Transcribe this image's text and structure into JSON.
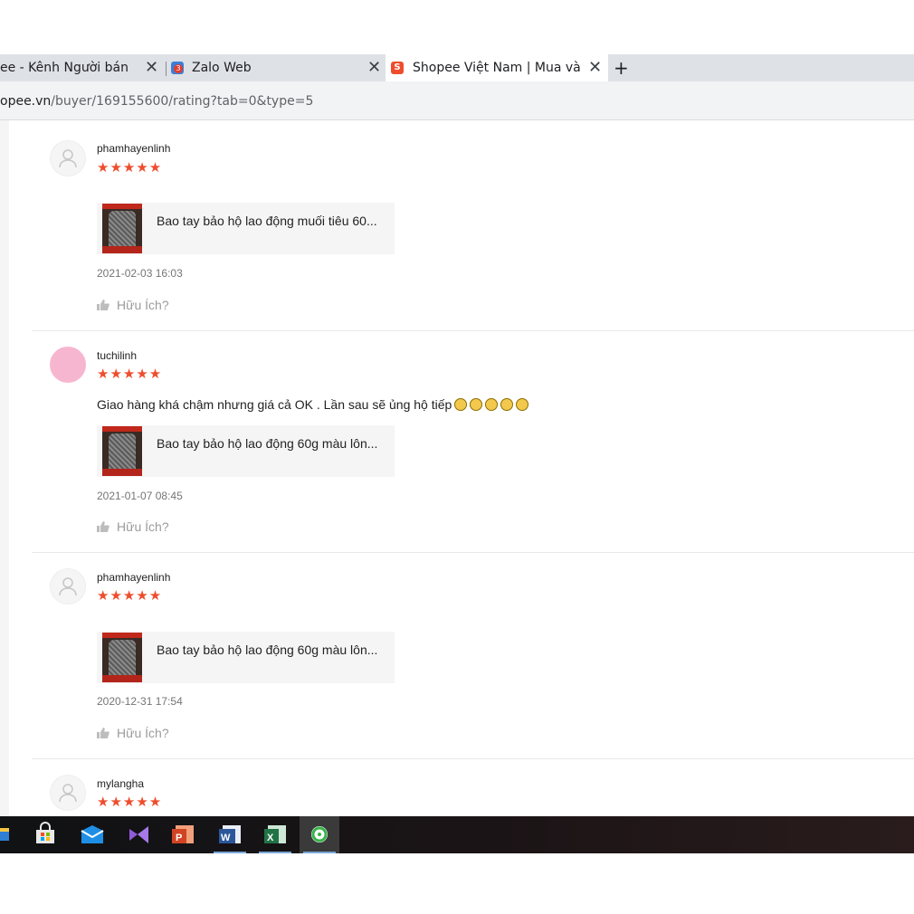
{
  "browser": {
    "tabs": [
      {
        "title": "ee - Kênh Người bán",
        "active": false
      },
      {
        "title": "Zalo Web",
        "active": false
      },
      {
        "title": "Shopee Việt Nam | Mua và Bá",
        "active": true
      }
    ],
    "zalo_badge": "3",
    "new_tab_label": "+",
    "url_domain": "opee.vn",
    "url_path": "/buyer/169155600/rating?tab=0&type=5"
  },
  "reviews": [
    {
      "username": "phamhayenlinh",
      "stars": "★★★★★",
      "comment": "",
      "product_title": "Bao tay bảo hộ lao động muối tiêu 60...",
      "date": "2021-02-03 16:03",
      "helpful_label": "Hữu Ích?"
    },
    {
      "username": "tuchilinh",
      "stars": "★★★★★",
      "comment": "Giao hàng khá chậm nhưng giá cả OK . Lần sau sẽ ủng hộ tiếp",
      "emoji_count": 5,
      "product_title": "Bao tay bảo hộ lao động 60g màu lôn...",
      "date": "2021-01-07 08:45",
      "helpful_label": "Hữu Ích?"
    },
    {
      "username": "phamhayenlinh",
      "stars": "★★★★★",
      "comment": "",
      "product_title": "Bao tay bảo hộ lao động 60g màu lôn...",
      "date": "2020-12-31 17:54",
      "helpful_label": "Hữu Ích?"
    },
    {
      "username": "mylangha",
      "stars": "★★★★★"
    }
  ],
  "colors": {
    "accent": "#ee4d2d",
    "tabbar": "#dee1e6",
    "addressbar": "#f1f3f4"
  },
  "taskbar": {
    "icons": [
      "file-explorer-icon",
      "store-icon",
      "mail-icon",
      "visual-studio-icon",
      "powerpoint-icon",
      "word-icon",
      "excel-icon",
      "coccoc-browser-icon"
    ]
  }
}
